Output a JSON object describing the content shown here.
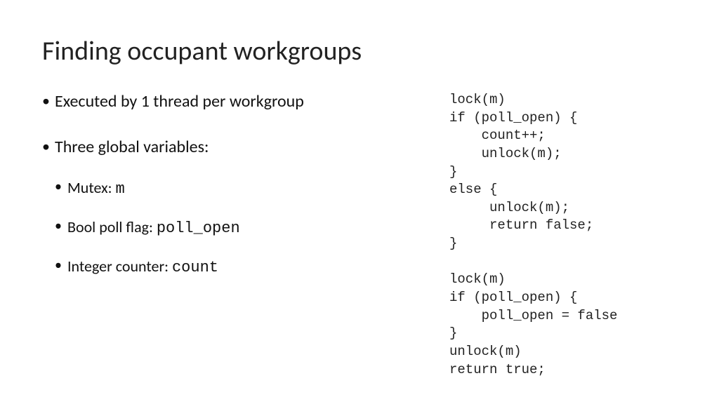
{
  "title": "Finding occupant workgroups",
  "bullets": {
    "b1": "Executed by 1 thread per workgroup",
    "b2": "Three global variables:",
    "sub": {
      "s1_label": "Mutex: ",
      "s1_code": "m",
      "s2_label": "Bool poll flag: ",
      "s2_code": "poll_open",
      "s3_label": "Integer counter: ",
      "s3_code": "count"
    }
  },
  "code": "lock(m)\nif (poll_open) {\n    count++;\n    unlock(m);\n}\nelse {\n     unlock(m);\n     return false;\n}\n\nlock(m)\nif (poll_open) {\n    poll_open = false\n}\nunlock(m)\nreturn true;"
}
